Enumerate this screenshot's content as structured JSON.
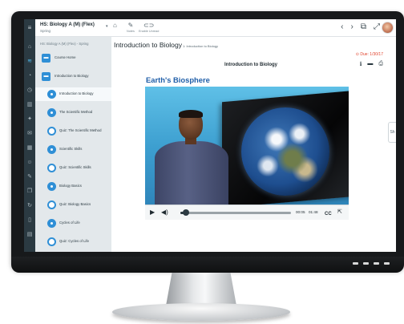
{
  "topbar": {
    "course_title": "HS: Biology A (M) (Flex)",
    "course_subtitle": "Spring",
    "tools": [
      {
        "label": "Notes",
        "icon": "pencil-icon"
      },
      {
        "label": "Enable Unread",
        "icon": "toggle-icon"
      }
    ]
  },
  "sidebar": {
    "header": "HS: Biology A (M) (Flex) - Spring",
    "items": [
      {
        "label": "Course Home",
        "kind": "folder"
      },
      {
        "label": "Introduction to Biology",
        "kind": "folder"
      },
      {
        "label": "Introduction to Biology",
        "kind": "lesson",
        "current": true
      },
      {
        "label": "The Scientific Method",
        "kind": "lesson"
      },
      {
        "label": "Quiz: The Scientific Method",
        "kind": "quiz"
      },
      {
        "label": "Scientific Skills",
        "kind": "lesson"
      },
      {
        "label": "Quiz: Scientific Skills",
        "kind": "quiz"
      },
      {
        "label": "Biology Basics",
        "kind": "lesson"
      },
      {
        "label": "Quiz: Biology Basics",
        "kind": "quiz"
      },
      {
        "label": "Cycles of Life",
        "kind": "lesson"
      },
      {
        "label": "Quiz: Cycles of Life",
        "kind": "quiz"
      }
    ]
  },
  "main": {
    "title": "Introduction to Biology",
    "breadcrumb": "1: Introduction to Biology",
    "due": "Due: 1/30/17",
    "section_title": "Introduction to Biology",
    "heading": "Earth's Biosphere",
    "side_tab": "Sh"
  },
  "video": {
    "current_time": "00:05",
    "duration": "01:48",
    "progress": 0.04,
    "cc_label": "CC"
  },
  "colors": {
    "accent": "#2f8fd6",
    "heading": "#1f5ea8",
    "due": "#e1452f",
    "rail": "#2b3a42"
  }
}
